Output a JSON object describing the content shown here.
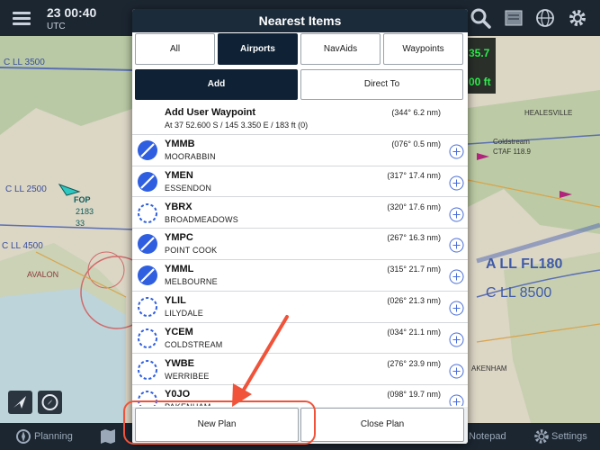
{
  "topbar": {
    "time": "23 00:40",
    "timezone": "UTC",
    "icons": [
      "menu-icon",
      "search-icon",
      "layers-icon",
      "globe-icon",
      "gear-icon"
    ]
  },
  "map_overlay": {
    "value_top": "35.7",
    "value_bottom": "00 ft",
    "labels": {
      "cll3500": "C LL 3500",
      "cll2500": "C LL 2500",
      "cll4500": "C LL 4500",
      "cll8500": "C LL 8500",
      "all180": "A LL FL180",
      "healesville": "HEALESVILLE",
      "coldstream": "Coldstream",
      "ctaf": "CTAF 118.9",
      "avalon": "AVALON",
      "fop": "FOP",
      "alt1": "2183",
      "alt2": "33",
      "akenham": "AKENHAM"
    }
  },
  "bottombar": {
    "planning": "Planning",
    "notepad": "Notepad",
    "settings": "Settings"
  },
  "modal": {
    "title": "Nearest Items",
    "tabs": [
      {
        "label": "All",
        "active": false
      },
      {
        "label": "Airports",
        "active": true
      },
      {
        "label": "NavAids",
        "active": false
      },
      {
        "label": "Waypoints",
        "active": false
      }
    ],
    "actions": [
      {
        "label": "Add",
        "active": true
      },
      {
        "label": "Direct To",
        "active": false
      }
    ],
    "user_waypoint": {
      "title": "Add User Waypoint",
      "subtitle": "At 37 52.600 S / 145 3.350 E / 183 ft (0)",
      "distance": "(344° 6.2 nm)"
    },
    "airports": [
      {
        "code": "YMMB",
        "name": "MOORABBIN",
        "distance": "(076° 0.5 nm)",
        "controlled": true
      },
      {
        "code": "YMEN",
        "name": "ESSENDON",
        "distance": "(317° 17.4 nm)",
        "controlled": true
      },
      {
        "code": "YBRX",
        "name": "BROADMEADOWS",
        "distance": "(320° 17.6 nm)",
        "controlled": false
      },
      {
        "code": "YMPC",
        "name": "POINT COOK",
        "distance": "(267° 16.3 nm)",
        "controlled": true
      },
      {
        "code": "YMML",
        "name": "MELBOURNE",
        "distance": "(315° 21.7 nm)",
        "controlled": true
      },
      {
        "code": "YLIL",
        "name": "LILYDALE",
        "distance": "(026° 21.3 nm)",
        "controlled": false
      },
      {
        "code": "YCEM",
        "name": "COLDSTREAM",
        "distance": "(034° 21.1 nm)",
        "controlled": false
      },
      {
        "code": "YWBE",
        "name": "WERRIBEE",
        "distance": "(276° 23.9 nm)",
        "controlled": false
      },
      {
        "code": "Y0JO",
        "name": "PAKENHAM",
        "distance": "(098° 19.7 nm)",
        "controlled": false
      }
    ],
    "footer": {
      "new_plan": "New Plan",
      "close_plan": "Close Plan"
    }
  },
  "colors": {
    "header": "#1c2b3a",
    "active_tab": "#0f2235",
    "airport_blue": "#2f5fe0",
    "annotation": "#f0533a"
  }
}
